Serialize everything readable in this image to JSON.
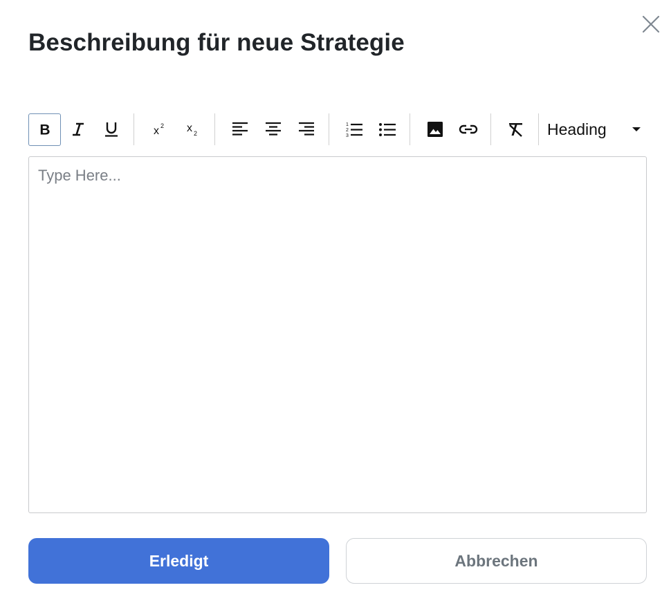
{
  "modal": {
    "title": "Beschreibung für neue Strategie"
  },
  "toolbar": {
    "buttons": [
      {
        "name": "bold",
        "label": "B"
      },
      {
        "name": "italic",
        "label": "I"
      },
      {
        "name": "underline",
        "label": "U"
      },
      {
        "name": "superscript",
        "label": "x²"
      },
      {
        "name": "subscript",
        "label": "x₂"
      }
    ],
    "heading_select": {
      "selected": "Heading"
    }
  },
  "editor": {
    "value": "",
    "placeholder": "Type Here..."
  },
  "actions": {
    "done_label": "Erledigt",
    "cancel_label": "Abbrechen"
  },
  "colors": {
    "primary": "#4172d8",
    "active_border": "#6e8fb4",
    "text": "#212529"
  }
}
